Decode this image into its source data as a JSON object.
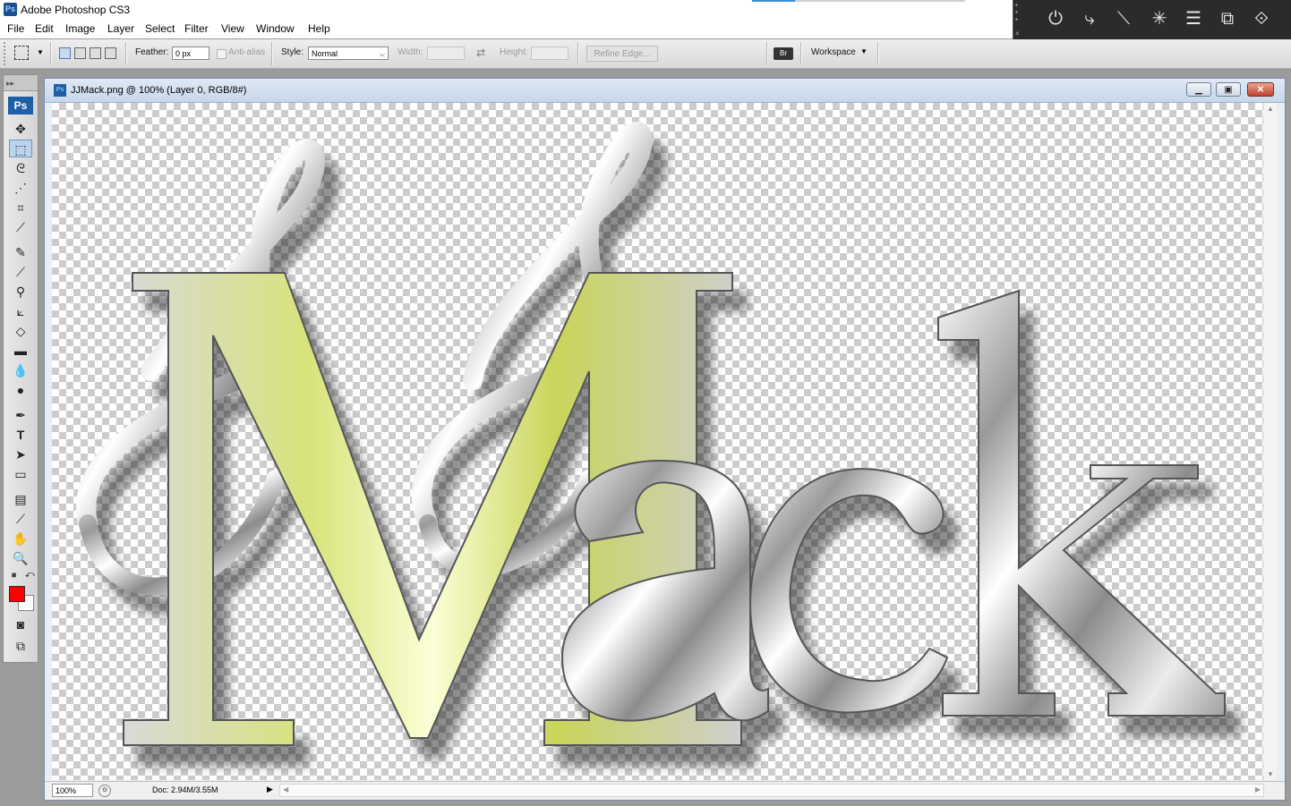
{
  "window": {
    "app_title": "Adobe Photoshop CS3",
    "app_icon_text": "Ps"
  },
  "menu": [
    "File",
    "Edit",
    "Image",
    "Layer",
    "Select",
    "Filter",
    "View",
    "Window",
    "Help"
  ],
  "options_bar": {
    "feather_label": "Feather:",
    "feather_value": "0 px",
    "antialias_label": "Anti-alias",
    "style_label": "Style:",
    "style_value": "Normal",
    "width_label": "Width:",
    "height_label": "Height:",
    "refine_edge_label": "Refine Edge...",
    "workspace_label": "Workspace"
  },
  "toolbox": {
    "ps_label": "Ps",
    "foreground_color": "#ff0000",
    "background_color": "#ffffff"
  },
  "document": {
    "title": "JJMack.png @ 100% (Layer 0, RGB/8#)",
    "zoom": "100%",
    "doc_info": "Doc: 2.94M/3.55M",
    "artwork_text": "Mack"
  },
  "colors": {
    "chrome": "#c0c0c0",
    "accent_yellow": "#d7e36a"
  }
}
